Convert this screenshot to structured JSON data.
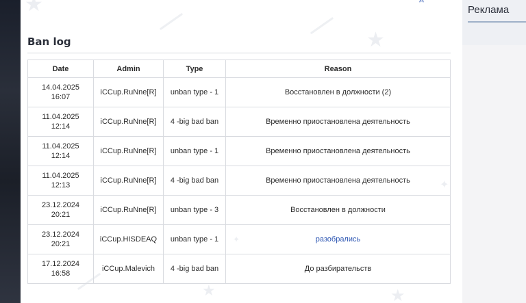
{
  "section": {
    "title": "Ban log"
  },
  "sidebar": {
    "ad_title": "Реклама"
  },
  "top_link": {
    "text": "д"
  },
  "table": {
    "headers": {
      "date": "Date",
      "admin": "Admin",
      "type": "Type",
      "reason": "Reason"
    },
    "rows": [
      {
        "date": "14.04.2025",
        "time": "16:07",
        "admin": "iCCup.RuNne[R]",
        "type": "unban type - 1",
        "reason": "Восстановлен в должности (2)"
      },
      {
        "date": "11.04.2025",
        "time": "12:14",
        "admin": "iCCup.RuNne[R]",
        "type": "4 -big bad ban",
        "reason": "Временно приостановлена деятельность"
      },
      {
        "date": "11.04.2025",
        "time": "12:14",
        "admin": "iCCup.RuNne[R]",
        "type": "unban type - 1",
        "reason": "Временно приостановлена деятельность"
      },
      {
        "date": "11.04.2025",
        "time": "12:13",
        "admin": "iCCup.RuNne[R]",
        "type": "4 -big bad ban",
        "reason": "Временно приостановлена деятельность"
      },
      {
        "date": "23.12.2024",
        "time": "20:21",
        "admin": "iCCup.RuNne[R]",
        "type": "unban type - 3",
        "reason": "Восстановлен в должности"
      },
      {
        "date": "23.12.2024",
        "time": "20:21",
        "admin": "iCCup.HISDEAQ",
        "type": "unban type - 1",
        "reason": "разобрались"
      },
      {
        "date": "17.12.2024",
        "time": "16:58",
        "admin": "iCCup.Malevich",
        "type": "4 -big bad ban",
        "reason": "До разбирательств"
      }
    ]
  },
  "colors": {
    "link": "#2e57b3",
    "border": "#d9dbe0",
    "background": "#ffffff"
  }
}
